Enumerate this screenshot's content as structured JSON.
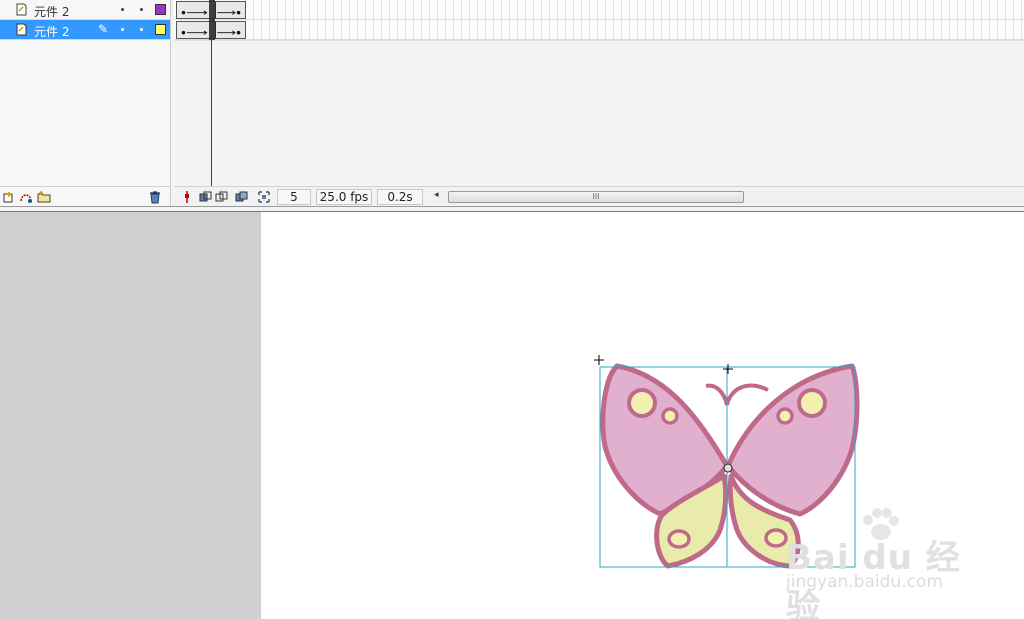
{
  "timeline": {
    "layers": [
      {
        "name": "元件 2",
        "selected": false,
        "color": "#9933cc"
      },
      {
        "name": "元件 2",
        "selected": true,
        "color": "#ffff66"
      }
    ],
    "status": {
      "current_frame": "5",
      "fps": "25.0 fps",
      "elapsed": "0.2s"
    },
    "scroll_thumb_grip": "III",
    "scroll_left_arrow": "◂"
  },
  "stage": {
    "pasteboard_color": "#cfcfcf",
    "stage_color": "#ffffff",
    "butterfly": {
      "wing_color": "#e2b0cf",
      "lower_wing_color": "#e8eba9",
      "outline_color": "#bf6a8b",
      "spot_color": "#f1f0b0"
    }
  },
  "watermark": {
    "brand": "Bai du 经验",
    "sub": "jingyan.baidu.com"
  }
}
